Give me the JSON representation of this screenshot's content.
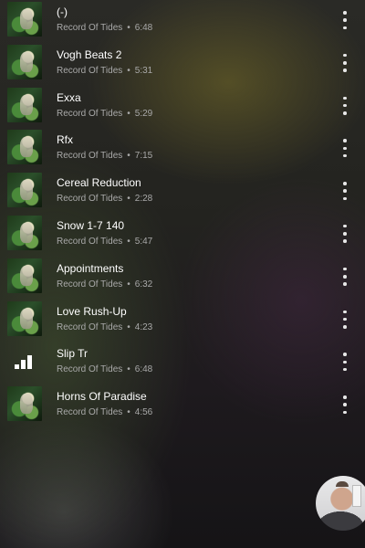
{
  "tracks": [
    {
      "title": "(-)",
      "artist": "Record Of Tides",
      "separator": "•",
      "duration": "6:48",
      "playing": false
    },
    {
      "title": "Vogh Beats 2",
      "artist": "Record Of Tides",
      "separator": "•",
      "duration": "5:31",
      "playing": false
    },
    {
      "title": "Exxa",
      "artist": "Record Of Tides",
      "separator": "•",
      "duration": "5:29",
      "playing": false
    },
    {
      "title": "Rfx",
      "artist": "Record Of Tides",
      "separator": "•",
      "duration": "7:15",
      "playing": false
    },
    {
      "title": "Cereal Reduction",
      "artist": "Record Of Tides",
      "separator": "•",
      "duration": "2:28",
      "playing": false
    },
    {
      "title": "Snow 1-7 140",
      "artist": "Record Of Tides",
      "separator": "•",
      "duration": "5:47",
      "playing": false
    },
    {
      "title": "Appointments",
      "artist": "Record Of Tides",
      "separator": "•",
      "duration": "6:32",
      "playing": false
    },
    {
      "title": "Love Rush-Up",
      "artist": "Record Of Tides",
      "separator": "•",
      "duration": "4:23",
      "playing": false
    },
    {
      "title": "Slip Tr",
      "artist": "Record Of Tides",
      "separator": "•",
      "duration": "6:48",
      "playing": true
    },
    {
      "title": "Horns Of Paradise",
      "artist": "Record Of Tides",
      "separator": "•",
      "duration": "4:56",
      "playing": false
    }
  ],
  "icons": {
    "more": "more-vert-icon",
    "now_playing": "equalizer-bars-icon"
  },
  "colors": {
    "title_text": "#ffffff",
    "meta_text": "#a9a9a9",
    "icon": "#e8e8e8"
  }
}
